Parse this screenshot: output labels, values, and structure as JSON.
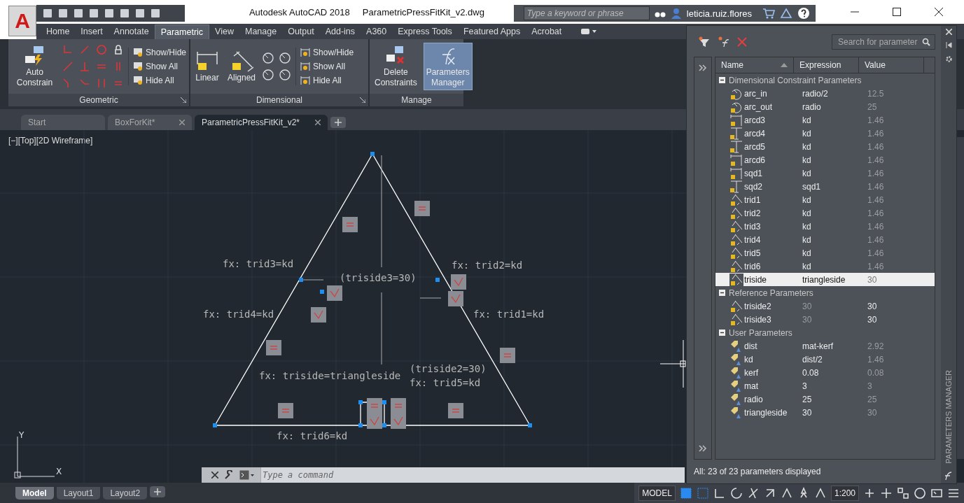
{
  "logo": "A",
  "title": {
    "app": "Autodesk AutoCAD 2018",
    "file": "ParametricPressFitKit_v2.dwg"
  },
  "search": {
    "placeholder": "Type a keyword or phrase"
  },
  "user": "leticia.ruiz.flores",
  "ribbon_tabs": [
    {
      "label": "Home",
      "selected": false
    },
    {
      "label": "Insert",
      "selected": false
    },
    {
      "label": "Annotate",
      "selected": false
    },
    {
      "label": "Parametric",
      "selected": true
    },
    {
      "label": "View",
      "selected": false
    },
    {
      "label": "Manage",
      "selected": false
    },
    {
      "label": "Output",
      "selected": false
    },
    {
      "label": "Add-ins",
      "selected": false
    },
    {
      "label": "A360",
      "selected": false
    },
    {
      "label": "Express Tools",
      "selected": false
    },
    {
      "label": "Featured Apps",
      "selected": false
    },
    {
      "label": "Acrobat",
      "selected": false
    }
  ],
  "panels": {
    "geometric": {
      "big": "Auto Constrain",
      "small": [
        "Show/Hide",
        "Show All",
        "Hide All"
      ],
      "title": "Geometric"
    },
    "dimensional": {
      "big": [
        "Linear",
        "Aligned"
      ],
      "small": [
        "Show/Hide",
        "Show All",
        "Hide All"
      ],
      "title": "Dimensional"
    },
    "manage": {
      "big": [
        {
          "label": "Delete Constraints",
          "selected": false
        },
        {
          "label": "Parameters Manager",
          "selected": true
        }
      ],
      "title": "Manage"
    }
  },
  "doc_tabs": [
    {
      "label": "Start",
      "selected": false
    },
    {
      "label": "BoxForKit*",
      "selected": false
    },
    {
      "label": "ParametricPressFitKit_v2*",
      "selected": true
    }
  ],
  "viewport_label": "[−][Top][2D Wireframe]",
  "canvas_labels": [
    "fx: trid3=kd",
    "(triside3=30)",
    "fx: trid2=kd",
    "fx: trid4=kd",
    "fx: trid1=kd",
    "fx: triside=triangleside",
    "(triside2=30)",
    "fx: trid5=kd",
    "fx: trid6=kd"
  ],
  "ucs": {
    "x": "X",
    "y": "Y"
  },
  "command": {
    "placeholder": "Type a command"
  },
  "layout_tabs": [
    {
      "label": "Model",
      "selected": true
    },
    {
      "label": "Layout1",
      "selected": false
    },
    {
      "label": "Layout2",
      "selected": false
    }
  ],
  "status_bar": {
    "model": "MODEL",
    "scale": "1:200"
  },
  "palette": {
    "search_placeholder": "Search for parameter",
    "columns": [
      "Name",
      "Expression",
      "Value"
    ],
    "groups": [
      {
        "label": "Dimensional Constraint Parameters",
        "kind": "dimensional",
        "expanded": true,
        "rows": [
          {
            "name": "arc_in",
            "expression": "radio/2",
            "value": "12.5",
            "kind": "radial",
            "selected": false
          },
          {
            "name": "arc_out",
            "expression": "radio",
            "value": "25",
            "kind": "radial",
            "selected": false
          },
          {
            "name": "arcd3",
            "expression": "kd",
            "value": "1.46",
            "kind": "horizontal",
            "selected": false
          },
          {
            "name": "arcd4",
            "expression": "kd",
            "value": "1.46",
            "kind": "vertical",
            "selected": false
          },
          {
            "name": "arcd5",
            "expression": "kd",
            "value": "1.46",
            "kind": "vertical",
            "selected": false
          },
          {
            "name": "arcd6",
            "expression": "kd",
            "value": "1.46",
            "kind": "horizontal",
            "selected": false
          },
          {
            "name": "sqd1",
            "expression": "kd",
            "value": "1.46",
            "kind": "horizontal",
            "selected": false
          },
          {
            "name": "sqd2",
            "expression": "sqd1",
            "value": "1.46",
            "kind": "vertical",
            "selected": false
          },
          {
            "name": "trid1",
            "expression": "kd",
            "value": "1.46",
            "kind": "aligned",
            "selected": false
          },
          {
            "name": "trid2",
            "expression": "kd",
            "value": "1.46",
            "kind": "aligned",
            "selected": false
          },
          {
            "name": "trid3",
            "expression": "kd",
            "value": "1.46",
            "kind": "aligned",
            "selected": false
          },
          {
            "name": "trid4",
            "expression": "kd",
            "value": "1.46",
            "kind": "aligned",
            "selected": false
          },
          {
            "name": "trid5",
            "expression": "kd",
            "value": "1.46",
            "kind": "aligned",
            "selected": false
          },
          {
            "name": "trid6",
            "expression": "kd",
            "value": "1.46",
            "kind": "aligned",
            "selected": false
          },
          {
            "name": "triside",
            "expression": "triangleside",
            "value": "30",
            "kind": "aligned",
            "selected": true
          }
        ]
      },
      {
        "label": "Reference Parameters",
        "kind": "reference",
        "expanded": true,
        "rows": [
          {
            "name": "triside2",
            "expression": "30",
            "value": "30",
            "kind": "aligned",
            "selected": false
          },
          {
            "name": "triside3",
            "expression": "30",
            "value": "30",
            "kind": "aligned",
            "selected": false
          }
        ]
      },
      {
        "label": "User Parameters",
        "kind": "user",
        "expanded": true,
        "rows": [
          {
            "name": "dist",
            "expression": "mat-kerf",
            "value": "2.92",
            "kind": "user",
            "selected": false
          },
          {
            "name": "kd",
            "expression": "dist/2",
            "value": "1.46",
            "kind": "user",
            "selected": false
          },
          {
            "name": "kerf",
            "expression": "0.08",
            "value": "0.08",
            "kind": "user",
            "selected": false
          },
          {
            "name": "mat",
            "expression": "3",
            "value": "3",
            "kind": "user",
            "selected": false
          },
          {
            "name": "radio",
            "expression": "25",
            "value": "25",
            "kind": "user",
            "selected": false
          },
          {
            "name": "triangleside",
            "expression": "30",
            "value": "30",
            "kind": "user",
            "selected": false
          }
        ]
      }
    ],
    "status": "All: 23 of 23 parameters displayed",
    "side_title": "PARAMETERS MANAGER"
  }
}
